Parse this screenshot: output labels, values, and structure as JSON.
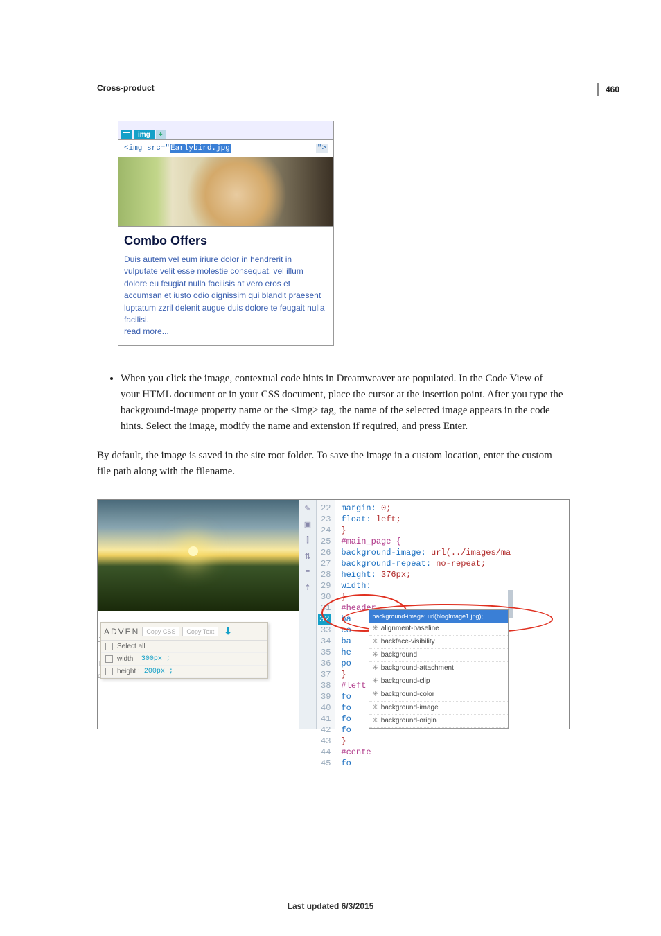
{
  "page_number": "460",
  "section_heading": "Cross-product",
  "figure1": {
    "tab_active": "img",
    "tab_plus": "+",
    "code_prefix": "<img src=\"",
    "code_selected": "Earlybird.jpg",
    "code_suffix_end": "\">",
    "heading": "Combo Offers",
    "body": "Duis autem vel eum iriure dolor in hendrerit in vulputate velit esse molestie consequat, vel illum dolore eu feugiat nulla facilisis at vero eros et accumsan et iusto odio dignissim qui blandit praesent luptatum zzril delenit augue duis dolore te feugait nulla facilisi.",
    "read_more": "read more..."
  },
  "bullet_text": "When you click the image, contextual code hints in Dreamweaver are populated. In the Code View of your HTML document or in your CSS document, place the cursor at the insertion point. After you type the background-image property name or the <img> tag, the name of the selected image appears in the code hints. Select the image, modify the name and extension if required, and press Enter.",
  "paragraph_text": "By default, the image is saved in the site root folder. To save the image in a custom location, enter the custom file path along with the filename.",
  "figure2": {
    "extract_panel": {
      "brand": "ADVEN",
      "btn_copy_css": "Copy CSS",
      "btn_copy_text": "Copy Text",
      "select_all": "Select all",
      "width_lbl": "width :",
      "width_val": "300px ;",
      "height_lbl": "height :",
      "height_val": "200px ;"
    },
    "left_captions": {
      "l1": "January",
      "l2": "These a",
      "l3": "deliver"
    },
    "gutter_icons": [
      "✎",
      "▣",
      "⫿",
      "⇅",
      "≡",
      "⇡"
    ],
    "line_start": 22,
    "lines": [
      {
        "n": 22,
        "txt": "    margin: 0;",
        "cls": [
          "prop",
          "val"
        ]
      },
      {
        "n": 23,
        "txt": "    float: left;"
      },
      {
        "n": 24,
        "txt": "}"
      },
      {
        "n": 25,
        "txt": "#main_page {"
      },
      {
        "n": 26,
        "txt": "    background-image: url(../images/ma"
      },
      {
        "n": 27,
        "txt": "    background-repeat: no-repeat;"
      },
      {
        "n": 28,
        "txt": "    height: 376px;"
      },
      {
        "n": 29,
        "txt": "    width:"
      },
      {
        "n": 30,
        "txt": "}"
      },
      {
        "n": 31,
        "txt": "#header"
      },
      {
        "n": 32,
        "txt": "    ba",
        "hl": true
      },
      {
        "n": 33,
        "txt": "    co"
      },
      {
        "n": 34,
        "txt": "    ba"
      },
      {
        "n": 35,
        "txt": "    he"
      },
      {
        "n": 36,
        "txt": "    po"
      },
      {
        "n": 37,
        "txt": "}"
      },
      {
        "n": 38,
        "txt": "#left"
      },
      {
        "n": 39,
        "txt": "    fo"
      },
      {
        "n": 40,
        "txt": "    fo"
      },
      {
        "n": 41,
        "txt": "    fo"
      },
      {
        "n": 42,
        "txt": "    fo"
      },
      {
        "n": 43,
        "txt": "}"
      },
      {
        "n": 44,
        "txt": "#cente"
      },
      {
        "n": 45,
        "txt": "    fo"
      }
    ],
    "hint_header": "background-image: url(blogImage1.jpg);",
    "hints": [
      "alignment-baseline",
      "backface-visibility",
      "background",
      "background-attachment",
      "background-clip",
      "background-color",
      "background-image",
      "background-origin"
    ]
  },
  "footer": "Last updated 6/3/2015"
}
